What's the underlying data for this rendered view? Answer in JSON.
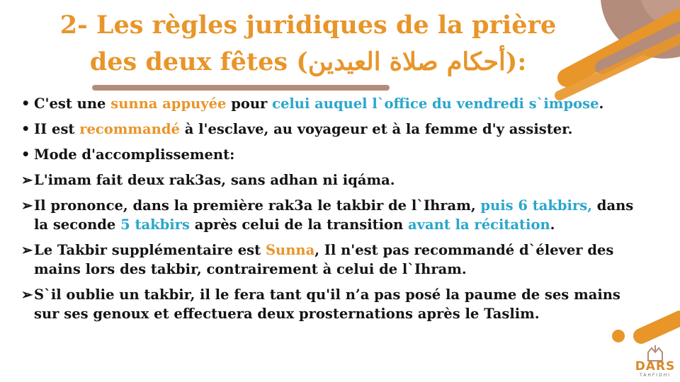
{
  "colors": {
    "accent_orange": "#e8952a",
    "accent_blue": "#2aa6cc",
    "deco_brown": "#b38c7c",
    "text": "#141414"
  },
  "title": {
    "line1": "2- Les règles juridiques de la prière",
    "line2": "des deux fêtes (أحكام صلاة العيدين):"
  },
  "items": [
    {
      "marker": "•",
      "segments": [
        {
          "text": "C'est une ",
          "color": "default"
        },
        {
          "text": "sunna appuyée",
          "color": "orange"
        },
        {
          "text": " pour ",
          "color": "default"
        },
        {
          "text": "celui auquel l`office du vendredi s`impose",
          "color": "blue"
        },
        {
          "text": ".",
          "color": "default"
        }
      ]
    },
    {
      "marker": "•",
      "segments": [
        {
          "text": "II est ",
          "color": "default"
        },
        {
          "text": "recommandé",
          "color": "orange"
        },
        {
          "text": " à l'esclave, au voyageur et à la femme d'y assister.",
          "color": "default"
        }
      ]
    },
    {
      "marker": "•",
      "segments": [
        {
          "text": "Mode d'accomplissement:",
          "color": "default"
        }
      ]
    },
    {
      "marker": "➢",
      "segments": [
        {
          "text": " L'imam fait deux rak3as, sans adhan ni iqáma.",
          "color": "default"
        }
      ]
    },
    {
      "marker": "➢",
      "segments": [
        {
          "text": " Il prononce, dans la première rak3a le takbir de l`Ihram, ",
          "color": "default"
        },
        {
          "text": "puis 6 takbirs,",
          "color": "blue"
        },
        {
          "text": " dans la seconde ",
          "color": "default"
        },
        {
          "text": "5 takbirs",
          "color": "blue"
        },
        {
          "text": " après celui de la transition ",
          "color": "default"
        },
        {
          "text": "avant la récitation",
          "color": "blue"
        },
        {
          "text": ".",
          "color": "default"
        }
      ]
    },
    {
      "marker": "➢",
      "segments": [
        {
          "text": " Le Takbir supplémentaire est ",
          "color": "default"
        },
        {
          "text": "Sunna",
          "color": "orange"
        },
        {
          "text": ", Il n'est pas recommandé d`élever des mains lors des takbir, contrairement à celui de l`Ihram.",
          "color": "default"
        }
      ]
    },
    {
      "marker": "➢",
      "segments": [
        {
          "text": " S`il oublie un takbir, il le fera tant qu'il n’a pas posé la paume de ses mains sur ses genoux et effectuera deux prosternations après le Taslim.",
          "color": "default"
        }
      ]
    }
  ],
  "logo": {
    "name": "DARS",
    "tagline": "TAHFIDHI"
  }
}
